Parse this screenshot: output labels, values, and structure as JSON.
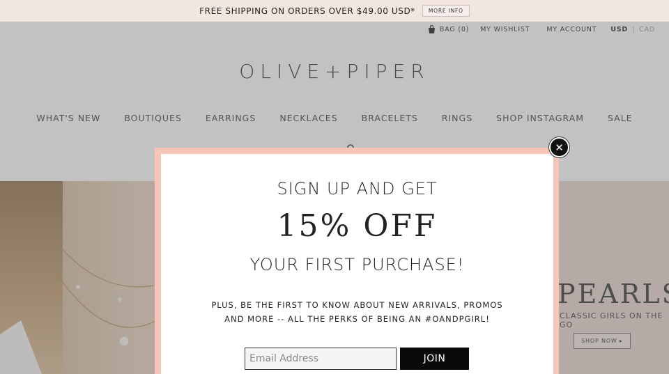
{
  "topbar": {
    "shipping_text": "FREE SHIPPING ON ORDERS OVER $49.00 USD*",
    "more_info": "MORE INFO"
  },
  "util": {
    "bag": "BAG (0)",
    "wishlist": "MY WISHLIST",
    "account": "MY ACCOUNT",
    "usd": "USD",
    "separator": "|",
    "cad": "CAD"
  },
  "logo": "OLIVE+PIPER",
  "nav": [
    "WHAT'S NEW",
    "BOUTIQUES",
    "EARRINGS",
    "NECKLACES",
    "BRACELETS",
    "RINGS",
    "SHOP INSTAGRAM",
    "SALE"
  ],
  "hero": {
    "title": "PEARLS",
    "subtitle": "CLASSIC GIRLS ON THE GO",
    "shop_now": "SHOP NOW ▸"
  },
  "modal": {
    "line1": "SIGN UP AND GET",
    "line2": "15% OFF",
    "line3": "YOUR FIRST PURCHASE!",
    "line4a": "PLUS, BE THE FIRST TO KNOW ABOUT NEW ARRIVALS, PROMOS",
    "line4b": "AND MORE -- ALL THE PERKS OF BEING AN #OANDPGIRL!",
    "email_placeholder": "Email Address",
    "join_label": "JOIN",
    "close_glyph": "✕"
  },
  "colors": {
    "topbar": "#f1e6e0",
    "modal_frame": "#f7c6b8",
    "join_button": "#0a0a0a",
    "hero_bg": "#e7d3cb"
  }
}
